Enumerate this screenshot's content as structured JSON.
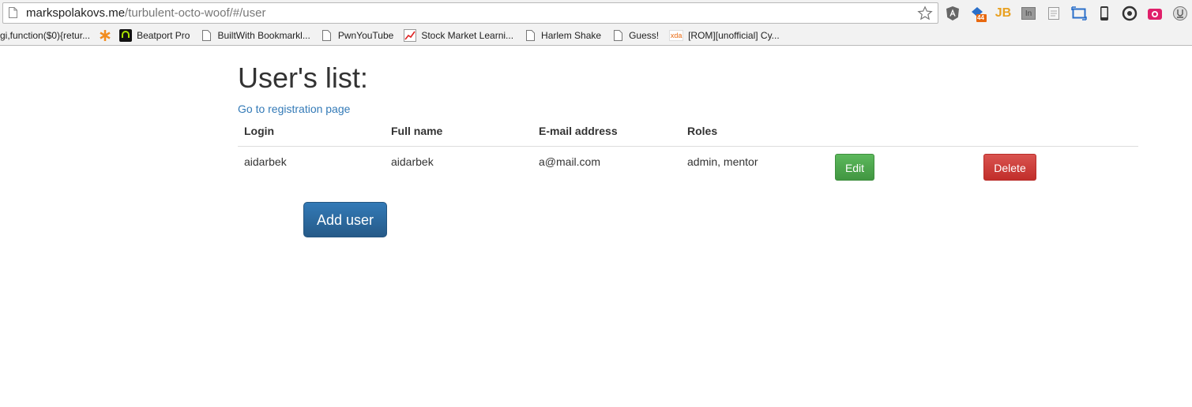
{
  "browser": {
    "url_host": "markspolakovs.me",
    "url_path": "/turbulent-octo-woof/#/user",
    "extensions": [
      {
        "name": "angular-icon"
      },
      {
        "name": "stack-badge-icon",
        "badge": "44"
      },
      {
        "name": "jb-icon",
        "label": "JB"
      },
      {
        "name": "in-icon",
        "label": "In"
      },
      {
        "name": "document-icon"
      },
      {
        "name": "window-resize-icon"
      },
      {
        "name": "phone-icon"
      },
      {
        "name": "refresh-circle-icon"
      },
      {
        "name": "camera-icon"
      },
      {
        "name": "user-circle-icon"
      }
    ],
    "bookmarks": [
      {
        "label": "gi,function($0){retur...",
        "icon": "none"
      },
      {
        "label": "",
        "icon": "asterisk-icon"
      },
      {
        "label": "Beatport Pro",
        "icon": "beatport-icon"
      },
      {
        "label": "BuiltWith Bookmarkl...",
        "icon": "page-icon"
      },
      {
        "label": "PwnYouTube",
        "icon": "page-icon"
      },
      {
        "label": "Stock Market Learni...",
        "icon": "chart-icon"
      },
      {
        "label": "Harlem Shake",
        "icon": "page-icon"
      },
      {
        "label": "Guess!",
        "icon": "page-icon"
      },
      {
        "label": "[ROM][unofficial] Cy...",
        "icon": "xda-icon"
      }
    ],
    "xda_label": "xda"
  },
  "page": {
    "title": "User's list:",
    "registration_link": "Go to registration page",
    "table": {
      "headers": [
        "Login",
        "Full name",
        "E-mail address",
        "Roles"
      ],
      "rows": [
        {
          "login": "aidarbek",
          "full_name": "aidarbek",
          "email": "a@mail.com",
          "roles": "admin, mentor",
          "edit_label": "Edit",
          "delete_label": "Delete"
        }
      ]
    },
    "add_user_label": "Add user"
  },
  "colors": {
    "link": "#337ab7",
    "success": "#5cb85c",
    "danger": "#d9534f",
    "primary": "#337ab7"
  }
}
